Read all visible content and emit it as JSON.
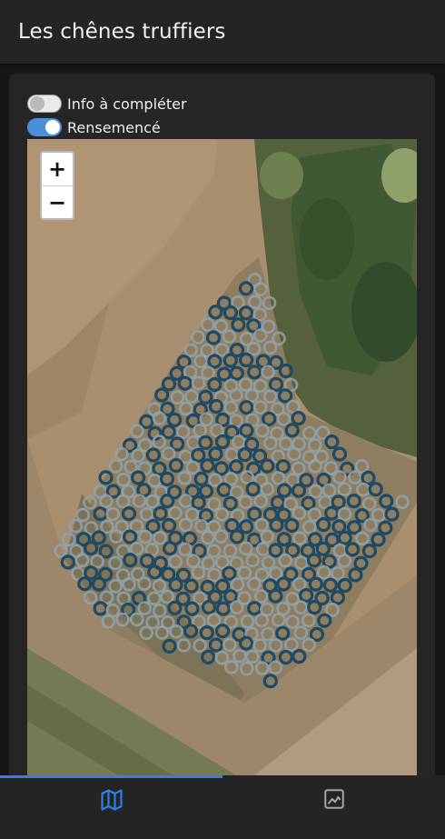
{
  "header": {
    "title": "Les chênes truffiers"
  },
  "filters": {
    "info_label": "Info à compléter",
    "info_on": false,
    "census_label": "Rensemencé",
    "census_on": true
  },
  "map": {
    "zoom_in_label": "+",
    "zoom_out_label": "−"
  },
  "tabs": [
    {
      "icon": "map-icon",
      "active": true
    },
    {
      "icon": "image-icon",
      "active": false
    }
  ],
  "colors": {
    "accent": "#2f7ff0",
    "marker_surveyed": "#1f4a63",
    "marker_pending": "#8fa3ad"
  }
}
